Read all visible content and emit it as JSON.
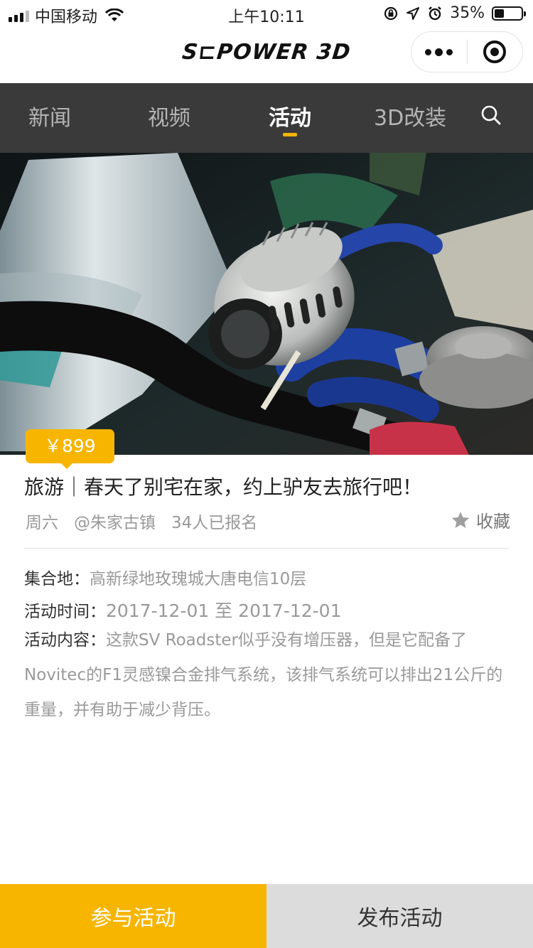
{
  "status_bar": {
    "carrier": "中国移动",
    "time": "上午10:11",
    "battery": "35%",
    "battery_level": 0.35,
    "icons": [
      "signal-icon",
      "wifi-icon",
      "orientation-lock-icon",
      "location-icon",
      "alarm-icon",
      "battery-icon"
    ]
  },
  "header": {
    "logo": "S⊏POWER 3D",
    "capsule_icons": [
      "more-icon",
      "close-miniprogram-icon"
    ]
  },
  "tabs": [
    {
      "label": "新闻",
      "active": false
    },
    {
      "label": "视频",
      "active": false
    },
    {
      "label": "活动",
      "active": true
    },
    {
      "label": "3D改装",
      "active": false
    }
  ],
  "search_icon": "search-icon",
  "event": {
    "price": "￥899",
    "title": "旅游｜春天了别宅在家，约上驴友去旅行吧！",
    "day": "周六",
    "location": "@朱家古镇",
    "signups": "34人已报名",
    "favorite_label": "收藏",
    "meeting_label": "集合地：",
    "meeting_value": "高新绿地玫瑰城大唐电信10层",
    "time_label": "活动时间：",
    "time_value": "2017-12-01 至 2017-12-01",
    "content_label": "活动内容：",
    "content_value": "这款SV Roadster似乎没有增压器，但是它配备了Novitec的F1灵感镍合金排气系统，该排气系统可以排出21公斤的重量，并有助于减少背压。"
  },
  "actions": {
    "join": "参与活动",
    "publish": "发布活动"
  },
  "colors": {
    "accent": "#f7b500",
    "tab_bar": "#3a3a3a"
  }
}
